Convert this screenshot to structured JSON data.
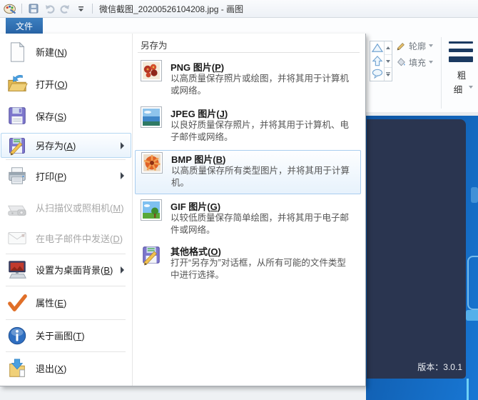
{
  "titlebar": {
    "title": "微信截图_20200526104208.jpg - 画图",
    "icons": [
      "paint-logo",
      "save-icon",
      "undo-icon",
      "redo-icon",
      "qat-dropdown-icon"
    ]
  },
  "tabs": {
    "file": "文件"
  },
  "file_menu": {
    "items": [
      {
        "label": "新建(N)",
        "icon": "new-document-icon",
        "disabled": false,
        "has_submenu": false
      },
      {
        "label": "打开(O)",
        "icon": "open-folder-icon",
        "disabled": false,
        "has_submenu": false
      },
      {
        "label": "保存(S)",
        "icon": "save-floppy-icon",
        "disabled": false,
        "has_submenu": false
      },
      {
        "label": "另存为(A)",
        "icon": "save-as-icon",
        "disabled": false,
        "has_submenu": true,
        "selected": true
      },
      {
        "label": "打印(P)",
        "icon": "printer-icon",
        "disabled": false,
        "has_submenu": true
      },
      {
        "label": "从扫描仪或照相机(M)",
        "icon": "scanner-camera-icon",
        "disabled": true,
        "has_submenu": false
      },
      {
        "label": "在电子邮件中发送(D)",
        "icon": "email-icon",
        "disabled": true,
        "has_submenu": false
      },
      {
        "label": "设置为桌面背景(B)",
        "icon": "desktop-background-icon",
        "disabled": false,
        "has_submenu": true
      },
      {
        "label": "属性(E)",
        "icon": "checkmark-icon",
        "disabled": false,
        "has_submenu": false
      },
      {
        "label": "关于画图(T)",
        "icon": "info-icon",
        "disabled": false,
        "has_submenu": false
      },
      {
        "label": "退出(X)",
        "icon": "exit-icon",
        "disabled": false,
        "has_submenu": false
      }
    ]
  },
  "save_as_submenu": {
    "header": "另存为",
    "items": [
      {
        "title": "PNG 图片(P)",
        "description": "以高质量保存照片或绘图，并将其用于计算机或网络。",
        "icon": "png-thumbnail-icon",
        "highlighted": false
      },
      {
        "title": "JPEG 图片(J)",
        "description": "以良好质量保存照片，并将其用于计算机、电子邮件或网络。",
        "icon": "jpeg-thumbnail-icon",
        "highlighted": false
      },
      {
        "title": "BMP 图片(B)",
        "description": "以高质量保存所有类型图片，并将其用于计算机。",
        "icon": "bmp-thumbnail-icon",
        "highlighted": true
      },
      {
        "title": "GIF 图片(G)",
        "description": "以较低质量保存简单绘图，并将其用于电子邮件或网络。",
        "icon": "gif-thumbnail-icon",
        "highlighted": false
      },
      {
        "title": "其他格式(O)",
        "description": "打开“另存为”对话框，从所有可能的文件类型中进行选择。",
        "icon": "save-as-icon",
        "highlighted": false
      }
    ]
  },
  "ribbon": {
    "shapes_icons": [
      "triangle-shape-icon",
      "arrow-shape-icon",
      "callout-shape-icon"
    ],
    "outline_label": "轮廓",
    "fill_label": "填充",
    "size_label_top": "粗",
    "size_label_bottom": "细"
  },
  "canvas": {
    "version_text": "版本：3.0.1"
  },
  "colors": {
    "tab_active": "#2a6cad",
    "menu_highlight_border": "#b5d7f2",
    "submenu_highlight_border": "#a9cdef",
    "canvas_blue": "#1166bf",
    "canvas_navy": "#2a3550",
    "size_bar_navy": "#1b3a61"
  }
}
